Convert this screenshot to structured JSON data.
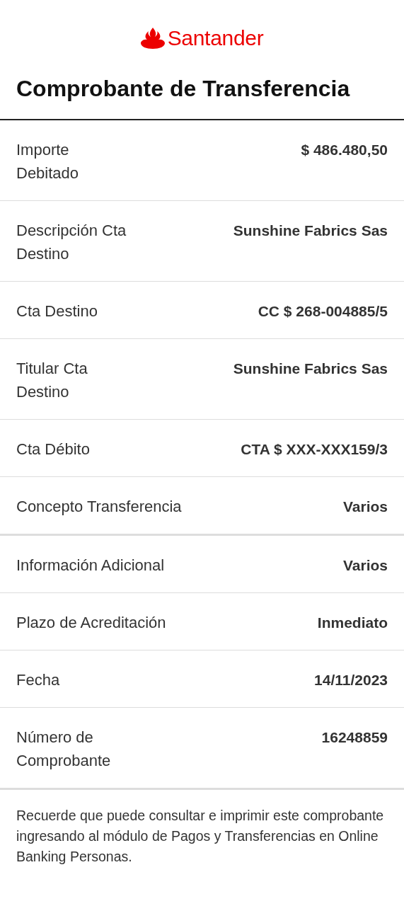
{
  "brand": {
    "name": "Santander"
  },
  "title": "Comprobante de Transferencia",
  "rows": [
    {
      "label": [
        "Importe",
        "Debitado"
      ],
      "value": "$ 486.480,50",
      "thick_divider": false
    },
    {
      "label": [
        "Descripción Cta",
        "Destino"
      ],
      "value": "Sunshine Fabrics Sas",
      "thick_divider": false
    },
    {
      "label": [
        "Cta Destino"
      ],
      "value": "CC $ 268-004885/5",
      "thick_divider": false
    },
    {
      "label": [
        "Titular Cta",
        "Destino"
      ],
      "value": "Sunshine Fabrics Sas",
      "thick_divider": false
    },
    {
      "label": [
        "Cta Débito"
      ],
      "value": "CTA $ XXX-XXX159/3",
      "thick_divider": false
    },
    {
      "label": [
        "Concepto Transferencia"
      ],
      "value": "Varios",
      "thick_divider": true
    },
    {
      "label": [
        "Información Adicional"
      ],
      "value": "Varios",
      "thick_divider": false
    },
    {
      "label": [
        "Plazo de Acreditación"
      ],
      "value": "Inmediato",
      "thick_divider": false
    },
    {
      "label": [
        "Fecha"
      ],
      "value": "14/11/2023",
      "thick_divider": false
    },
    {
      "label": [
        "Número de",
        "Comprobante"
      ],
      "value": "16248859",
      "thick_divider": true
    }
  ],
  "footer": "Recuerde que puede consultar e imprimir este comprobante ingresando al módulo de Pagos y Transferencias en Online Banking Personas."
}
